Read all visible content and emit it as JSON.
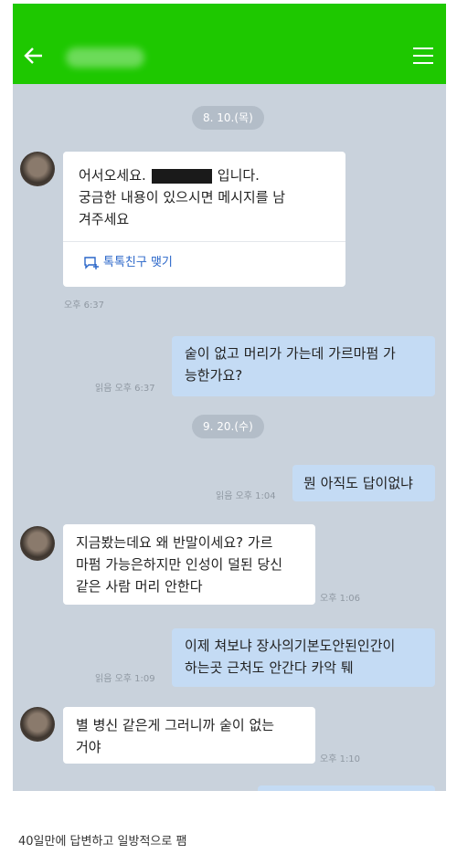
{
  "header": {
    "icon": "arrow-left-icon",
    "menu_icon": "menu-icon"
  },
  "dates": [
    "8. 10.(목)",
    "9. 20.(수)"
  ],
  "messages": [
    {
      "side": "in",
      "line1_prefix": "어서오세요.",
      "line1_suffix": "입니다.",
      "line2": "궁금한 내용이 있으시면 메시지를 남",
      "line3": "겨주세요",
      "link": "톡톡친구 맺기",
      "time": "오후 6:37"
    },
    {
      "side": "out",
      "line1": "숱이 없고 머리가 가는데 가르마펌 가",
      "line2": "능한가요?",
      "time": "읽음 오후 6:37"
    },
    {
      "side": "out",
      "line1": "뭔 아직도 답이없냐",
      "time": "읽음 오후 1:04"
    },
    {
      "side": "in",
      "line1": "지금봤는데요 왜 반말이세요? 가르",
      "line2": "마펌 가능은하지만 인성이 덜된 당신",
      "line3": "같은 사람 머리 안한다",
      "time": "오후 1:06"
    },
    {
      "side": "out",
      "line1": "이제 쳐보냐 장사의기본도안된인간이",
      "line2": "하는곳 근처도 안간다 카악 퉤",
      "time": "읽음 오후 1:09"
    },
    {
      "side": "in",
      "line1": "별 병신 같은게 그러니까 숱이 없는",
      "line2": "거야",
      "time": "오후 1:10"
    }
  ],
  "caption": "40일만에 답변하고 일방적으로 팸",
  "colors": {
    "header": "#1ec800",
    "chat_bg": "#c9d2dc",
    "outgoing": "#c4dbf4",
    "incoming": "#ffffff"
  }
}
